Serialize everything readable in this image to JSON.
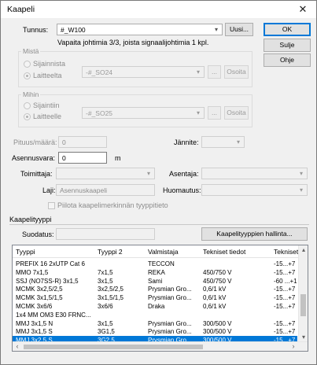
{
  "window": {
    "title": "Kaapeli",
    "close_glyph": "✕"
  },
  "buttons": {
    "ok": "OK",
    "sulje": "Sulje",
    "ohje": "Ohje",
    "uusi": "Uusi...",
    "browse": "...",
    "osoita": "Osoita",
    "hallinta": "Kaapelityyppien hallinta..."
  },
  "tunnus": {
    "label": "Tunnus:",
    "value": "#_W100",
    "info": "Vapaita johtimia 3/3, joista signaalijohtimia 1 kpl."
  },
  "mista": {
    "title": "Mistä",
    "radio1": "Sijainnista",
    "radio2": "Laitteelta",
    "value": "-#_SO24"
  },
  "mihin": {
    "title": "Mihin",
    "radio1": "Sijaintiin",
    "radio2": "Laitteelle",
    "value": "-#_SO25"
  },
  "fields": {
    "pituus_label": "Pituus/määrä:",
    "pituus_value": "0",
    "jannite_label": "Jännite:",
    "asennusvara_label": "Asennusvara:",
    "asennusvara_value": "0",
    "asennusvara_unit": "m",
    "toimittaja_label": "Toimittaja:",
    "asentaja_label": "Asentaja:",
    "laji_label": "Laji:",
    "laji_value": "Asennuskaapeli",
    "huomautus_label": "Huomautus:",
    "piilota_label": "Piilota kaapelimerkinnän tyyppitieto"
  },
  "kaapelityyppi": {
    "title": "Kaapelityyppi",
    "suodatus_label": "Suodatus:"
  },
  "list": {
    "columns": [
      "Tyyppi",
      "Tyyppi 2",
      "Valmistaja",
      "Tekniset tiedot",
      "Tekniset"
    ],
    "rows": [
      [
        "PREFIX 16 2xUTP Cat 6",
        "",
        "TECCON",
        "",
        "-15...+7"
      ],
      [
        "MMO 7x1,5",
        "7x1,5",
        "REKA",
        "450/750 V",
        "-15...+7"
      ],
      [
        "SSJ (NO7SS-R) 3x1,5",
        "3x1,5",
        "Sami",
        "450/750 V",
        "-60 ...+1"
      ],
      [
        "MCMK 3x2,5/2,5",
        "3x2,5/2,5",
        "Prysmian Gro...",
        "0,6/1 kV",
        "-15...+7"
      ],
      [
        "MCMK 3x1,5/1,5",
        "3x1,5/1,5",
        "Prysmian Gro...",
        "0,6/1 kV",
        "-15...+7"
      ],
      [
        "MCMK 3x6/6",
        "3x6/6",
        "Draka",
        "0,6/1 kV",
        "-15...+7"
      ],
      [
        "1x4 MM OM3 E30  FRNC...",
        "",
        "",
        "",
        ""
      ],
      [
        "MMJ 3x1,5 N",
        "3x1,5",
        "Prysmian Gro...",
        "300/500 V",
        "-15...+7"
      ],
      [
        "MMJ 3x1,5 S",
        "3G1,5",
        "Prysmian Gro...",
        "300/500 V",
        "-15...+7"
      ],
      [
        "MMJ 3x2,5 S",
        "3G2,5",
        "Prysmian Gro...",
        "300/500 V",
        "-15...+7"
      ]
    ],
    "selected_index": 9
  }
}
